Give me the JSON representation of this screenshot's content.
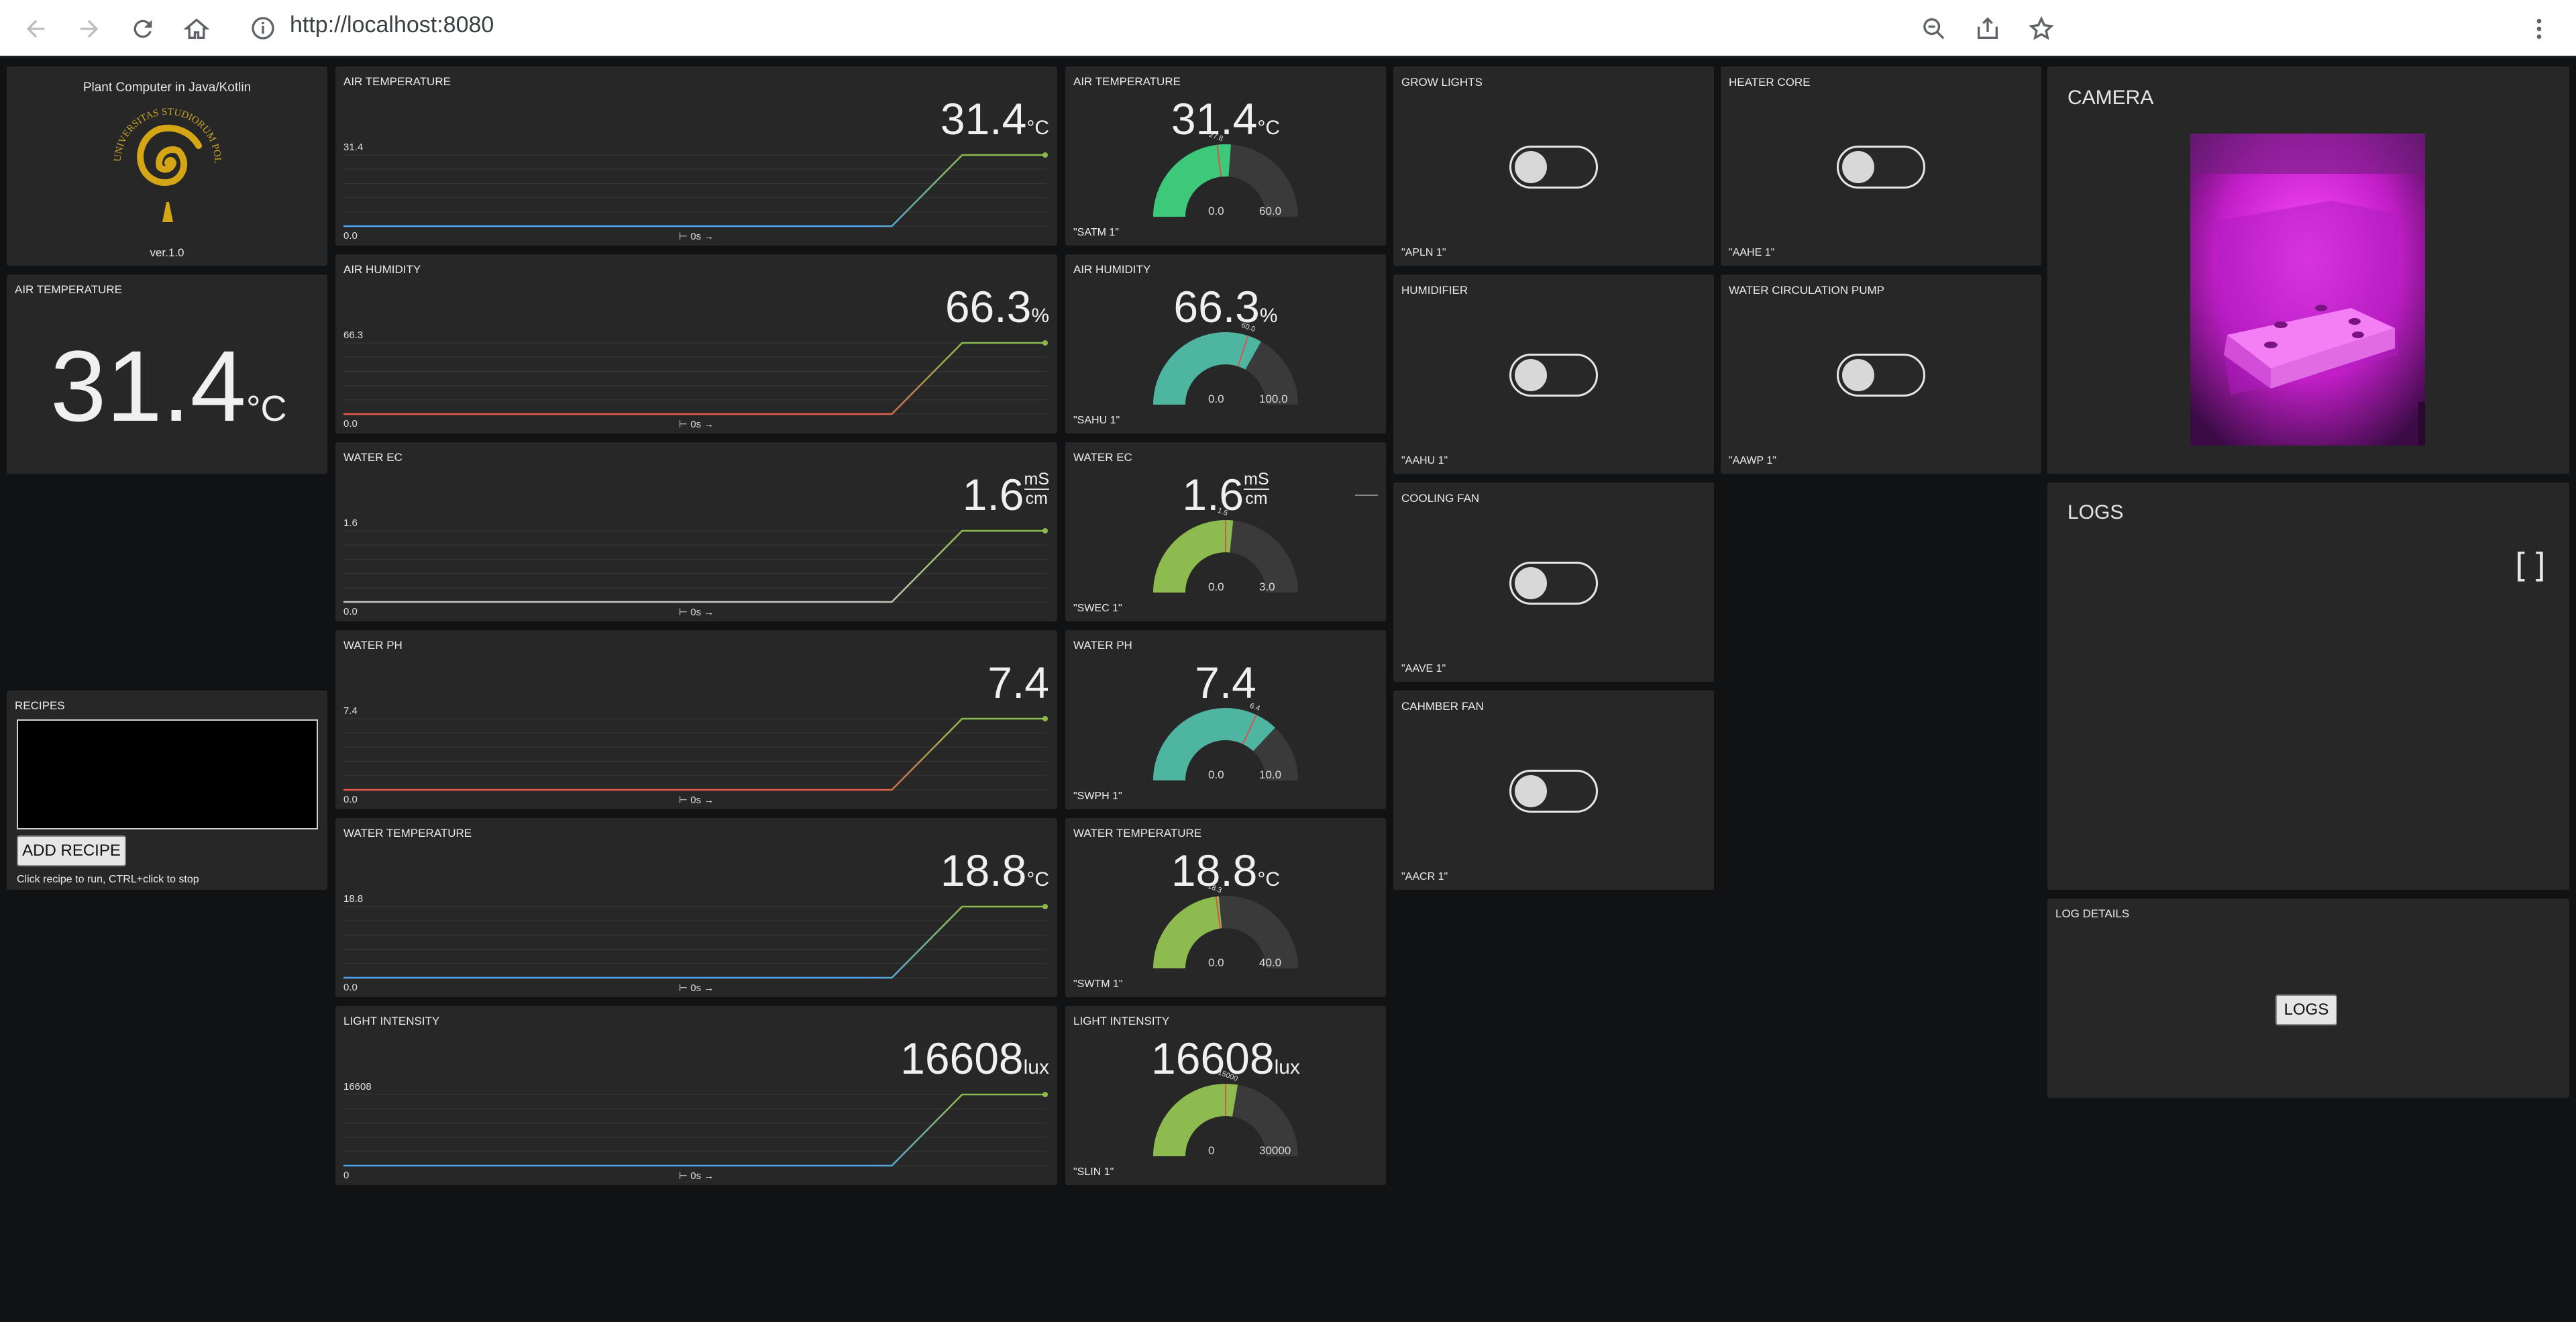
{
  "browser": {
    "url": "http://localhost:8080"
  },
  "app": {
    "title": "Plant Computer in Java/Kotlin",
    "version": "ver.1.0",
    "logo_text": "UNIVERSITAS STUDIORUM POLENSIS GEORGII DOBRILA"
  },
  "air_temp_big": {
    "title": "AIR TEMPERATURE",
    "value": "31.4",
    "unit": "°C"
  },
  "charts": [
    {
      "title": "AIR TEMPERATURE",
      "value": "31.4",
      "unit": "°C",
      "max_label": "31.4",
      "min_label": "0.0",
      "color": "#4ea3f0"
    },
    {
      "title": "AIR HUMIDITY",
      "value": "66.3",
      "unit": "%",
      "max_label": "66.3",
      "min_label": "0.0",
      "color": "#e8564a"
    },
    {
      "title": "WATER EC",
      "value": "1.6",
      "unit_num": "mS",
      "unit_den": "cm",
      "max_label": "1.6",
      "min_label": "0.0",
      "color": "#c8c8c8"
    },
    {
      "title": "WATER PH",
      "value": "7.4",
      "unit": "",
      "max_label": "7.4",
      "min_label": "0.0",
      "color": "#e8564a"
    },
    {
      "title": "WATER TEMPERATURE",
      "value": "18.8",
      "unit": "°C",
      "max_label": "18.8",
      "min_label": "0.0",
      "color": "#4ea3f0"
    },
    {
      "title": "LIGHT INTENSITY",
      "value": "16608",
      "unit": "lux",
      "max_label": "16608",
      "min_label": "0",
      "color": "#4ea3f0"
    }
  ],
  "chart_xlabel": "⊢ 0s →",
  "chart_data": [
    {
      "type": "line",
      "title": "AIR TEMPERATURE",
      "series": [
        {
          "x": [
            0,
            0.78,
            0.88,
            1
          ],
          "y": [
            0,
            0,
            31.4,
            31.4
          ]
        }
      ],
      "ylim": [
        0,
        31.4
      ]
    },
    {
      "type": "line",
      "title": "AIR HUMIDITY",
      "series": [
        {
          "x": [
            0,
            0.78,
            0.88,
            1
          ],
          "y": [
            0,
            0,
            66.3,
            66.3
          ]
        }
      ],
      "ylim": [
        0,
        66.3
      ]
    },
    {
      "type": "line",
      "title": "WATER EC",
      "series": [
        {
          "x": [
            0,
            0.78,
            0.88,
            1
          ],
          "y": [
            0,
            0,
            1.6,
            1.6
          ]
        }
      ],
      "ylim": [
        0,
        1.6
      ]
    },
    {
      "type": "line",
      "title": "WATER PH",
      "series": [
        {
          "x": [
            0,
            0.78,
            0.88,
            1
          ],
          "y": [
            0,
            0,
            7.4,
            7.4
          ]
        }
      ],
      "ylim": [
        0,
        7.4
      ]
    },
    {
      "type": "line",
      "title": "WATER TEMPERATURE",
      "series": [
        {
          "x": [
            0,
            0.78,
            0.88,
            1
          ],
          "y": [
            0,
            0,
            18.8,
            18.8
          ]
        }
      ],
      "ylim": [
        0,
        18.8
      ]
    },
    {
      "type": "line",
      "title": "LIGHT INTENSITY",
      "series": [
        {
          "x": [
            0,
            0.78,
            0.88,
            1
          ],
          "y": [
            0,
            0,
            16608,
            16608
          ]
        }
      ],
      "ylim": [
        0,
        16608
      ]
    }
  ],
  "gauges": [
    {
      "title": "AIR TEMPERATURE",
      "value": "31.4",
      "unit": "°C",
      "v": 31.4,
      "min": 0,
      "max": 60,
      "min_label": "0.0",
      "max_label": "60.0",
      "marker": 27.8,
      "marker_label": "27.8",
      "color": "#3ec87a",
      "topic": "\"SATM 1\""
    },
    {
      "title": "AIR HUMIDITY",
      "value": "66.3",
      "unit": "%",
      "v": 66.3,
      "min": 0,
      "max": 100,
      "min_label": "0.0",
      "max_label": "100.0",
      "marker": 60,
      "marker_label": "60.0",
      "color": "#4db5a0",
      "topic": "\"SAHU 1\""
    },
    {
      "title": "WATER EC",
      "value": "1.6",
      "unit_num": "mS",
      "unit_den": "cm",
      "v": 1.6,
      "min": 0,
      "max": 3,
      "min_label": "0.0",
      "max_label": "3.0",
      "marker": 1.5,
      "marker_label": "1.5",
      "color": "#8dbb4f",
      "topic": "\"SWEC 1\""
    },
    {
      "title": "WATER PH",
      "value": "7.4",
      "unit": "",
      "v": 7.4,
      "min": 0,
      "max": 10,
      "min_label": "0.0",
      "max_label": "10.0",
      "marker": 6.4,
      "marker_label": "6.4",
      "color": "#4db5a0",
      "topic": "\"SWPH 1\""
    },
    {
      "title": "WATER TEMPERATURE",
      "value": "18.8",
      "unit": "°C",
      "v": 18.8,
      "min": 0,
      "max": 40,
      "min_label": "0.0",
      "max_label": "40.0",
      "marker": 18.3,
      "marker_label": "18.3",
      "color": "#8dbb4f",
      "topic": "\"SWTM 1\""
    },
    {
      "title": "LIGHT INTENSITY",
      "value": "16608",
      "unit": "lux",
      "v": 16608,
      "min": 0,
      "max": 30000,
      "min_label": "0",
      "max_label": "30000",
      "marker": 15000,
      "marker_label": "15000",
      "color": "#8dbb4f",
      "topic": "\"SLIN 1\""
    }
  ],
  "switches": [
    {
      "title": "GROW LIGHTS",
      "topic": "\"APLN 1\""
    },
    {
      "title": "HEATER CORE",
      "topic": "\"AAHE 1\""
    },
    {
      "title": "HUMIDIFIER",
      "topic": "\"AAHU 1\""
    },
    {
      "title": "WATER CIRCULATION PUMP",
      "topic": "\"AAWP 1\""
    },
    {
      "title": "COOLING FAN",
      "topic": "\"AAVE 1\""
    },
    {
      "title": "CAHMBER FAN",
      "topic": "\"AACR 1\""
    }
  ],
  "recipes": {
    "title": "RECIPES",
    "button": "ADD RECIPE",
    "hint": "Click recipe to run, CTRL+click to stop"
  },
  "camera": {
    "title": "CAMERA"
  },
  "logs": {
    "title": "LOGS",
    "content": "[]"
  },
  "log_details": {
    "title": "LOG DETAILS",
    "button": "LOGS"
  }
}
